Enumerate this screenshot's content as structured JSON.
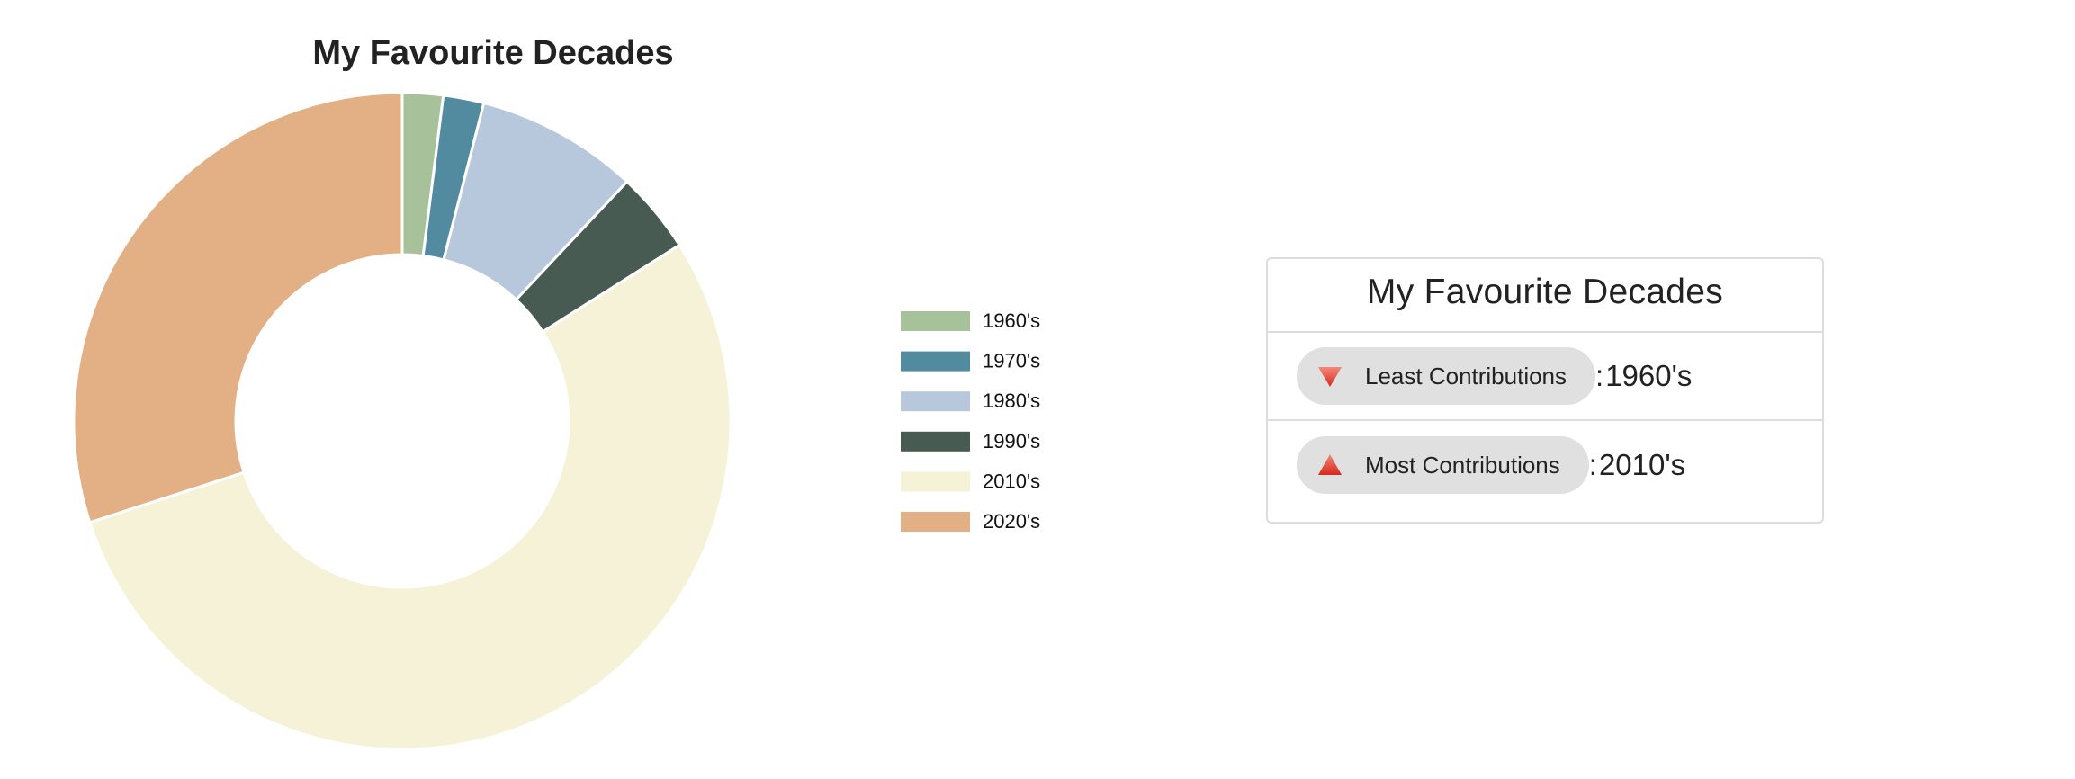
{
  "chart_data": {
    "type": "pie",
    "donut": true,
    "title": "My Favourite Decades",
    "categories": [
      "1960's",
      "1970's",
      "1980's",
      "1990's",
      "2010's",
      "2020's"
    ],
    "values": [
      2,
      2,
      8,
      4,
      54,
      30
    ],
    "colors": [
      "#a7c29a",
      "#528aa0",
      "#b8c8dc",
      "#485b52",
      "#f5f2d7",
      "#e2b084"
    ],
    "legend_position": "right"
  },
  "summary": {
    "title": "My Favourite Decades",
    "least_label": "Least Contributions",
    "least_sep": ":",
    "least_value": "1960's",
    "most_label": "Most Contributions",
    "most_sep": ":",
    "most_value": "2010's",
    "least_icon": "red-down-triangle-icon",
    "most_icon": "red-up-triangle-icon"
  }
}
